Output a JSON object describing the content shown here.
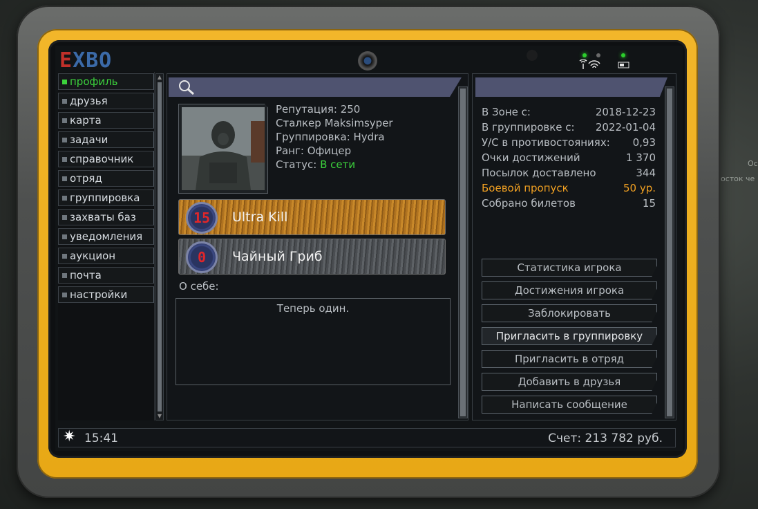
{
  "background": {
    "text_1": "Ос",
    "text_2": "осток че"
  },
  "device": {
    "logo_prefix": "E",
    "logo_rest": "XBO",
    "accent_yellow": "#f2b62a",
    "status_icons": [
      "signal-icon",
      "wifi-icon",
      "battery-icon"
    ]
  },
  "sidebar": {
    "items": [
      {
        "label": "профиль",
        "active": true
      },
      {
        "label": "друзья"
      },
      {
        "label": "карта"
      },
      {
        "label": "задачи"
      },
      {
        "label": "справочник"
      },
      {
        "label": "отряд"
      },
      {
        "label": "группировка"
      },
      {
        "label": "захваты баз"
      },
      {
        "label": "уведомления"
      },
      {
        "label": "аукцион"
      },
      {
        "label": "почта"
      },
      {
        "label": "настройки"
      }
    ]
  },
  "profile": {
    "reputation": "Репутация: 250",
    "stalker": "Сталкер Maksimsyper",
    "faction": "Группировка: Hydra",
    "rank": "Ранг: Офицер",
    "status_label": "Статус: ",
    "status_value": "В сети",
    "achievements": [
      {
        "number": "15",
        "title": "Ultra Kill"
      },
      {
        "number": "0",
        "title": "Чайный Гриб"
      }
    ],
    "about_label": "О себе:",
    "about_text": "Теперь один."
  },
  "stats": [
    {
      "label": "В Зоне с:",
      "value": "2018-12-23"
    },
    {
      "label": "В группировке с:",
      "value": "2022-01-04"
    },
    {
      "label": "У/С в противостояниях:",
      "value": "0,93"
    },
    {
      "label": "Очки достижений",
      "value": "1 370"
    },
    {
      "label": "Посылок доставлено",
      "value": "344"
    },
    {
      "label": "Боевой пропуск",
      "value": "50 ур.",
      "highlight": true
    },
    {
      "label": "Собрано билетов",
      "value": "15"
    }
  ],
  "actions": [
    "Статистика игрока",
    "Достижения игрока",
    "Заблокировать",
    "Пригласить в группировку",
    "Пригласить в отряд",
    "Добавить в друзья",
    "Написать сообщение"
  ],
  "footer": {
    "time": "15:41",
    "balance": "Счет: 213 782 руб."
  }
}
